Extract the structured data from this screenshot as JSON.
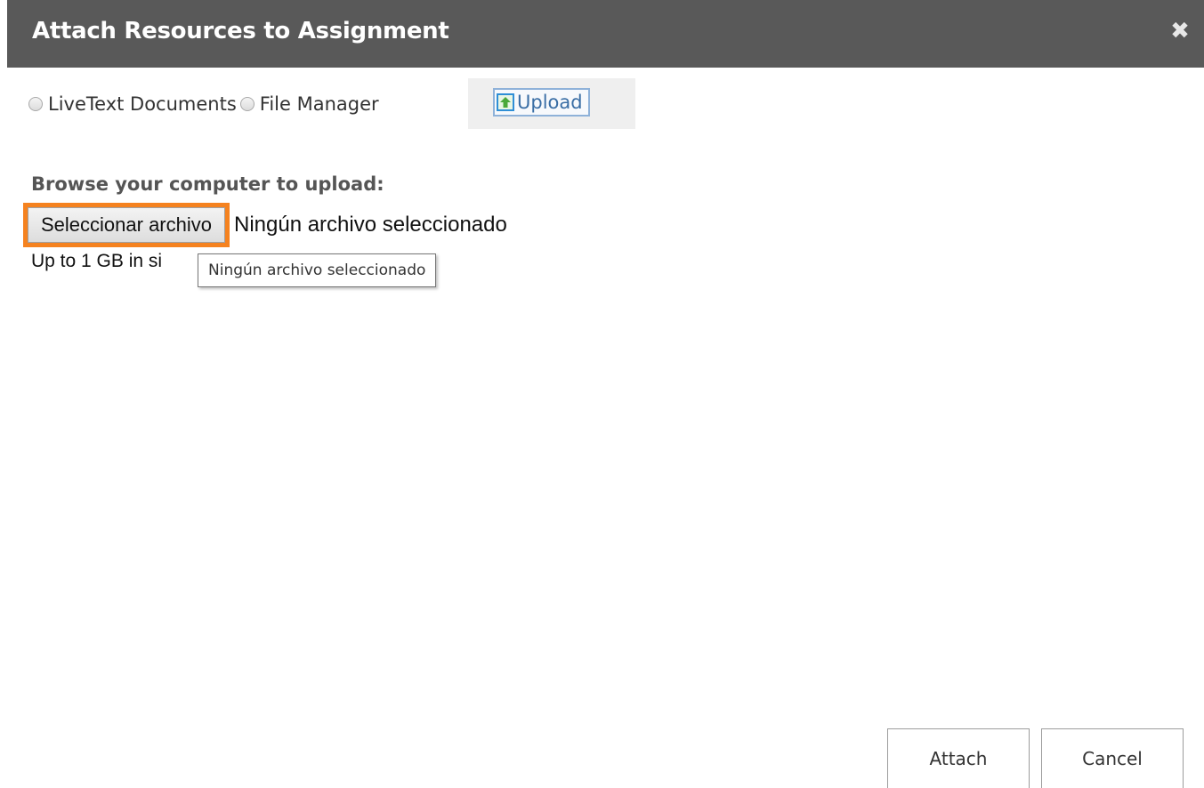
{
  "dialog": {
    "title": "Attach Resources to Assignment",
    "close_icon": "close-icon",
    "close_symbol": "✖"
  },
  "sources": {
    "livetext_label": "LiveText Documents",
    "file_manager_label": "File Manager",
    "upload_label": "Upload",
    "upload_icon": "upload-arrow-icon"
  },
  "upload_panel": {
    "browse_label": "Browse your computer to upload:",
    "choose_file_label": "Seleccionar archivo",
    "file_status": "Ningún archivo seleccionado",
    "size_note": "Up to 1 GB in si",
    "tooltip": "Ningún archivo seleccionado"
  },
  "footer": {
    "attach_label": "Attach",
    "cancel_label": "Cancel"
  },
  "colors": {
    "titlebar": "#595959",
    "focus_outline": "#f5821f",
    "upload_accent": "#3a6ea5"
  }
}
